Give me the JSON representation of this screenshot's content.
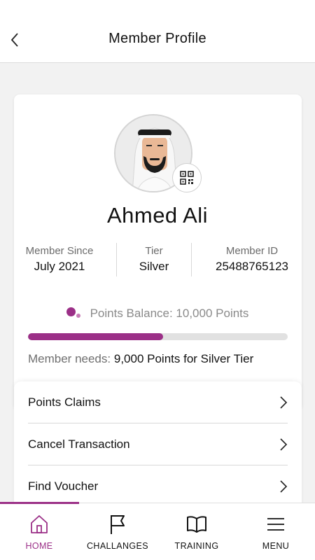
{
  "header": {
    "title": "Member Profile"
  },
  "profile": {
    "name": "Ahmed Ali",
    "stats": [
      {
        "label": "Member Since",
        "value": "July 2021"
      },
      {
        "label": "Tier",
        "value": "Silver"
      },
      {
        "label": "Member ID",
        "value": "25488765123"
      }
    ],
    "points_balance": "Points Balance: 10,000 Points",
    "progress_fraction": 0.52,
    "needs_prefix": "Member needs:",
    "needs_value": "9,000 Points for Silver Tier"
  },
  "menu": {
    "items": [
      {
        "label": "Points Claims"
      },
      {
        "label": "Cancel Transaction"
      },
      {
        "label": "Find Voucher"
      }
    ]
  },
  "nav": {
    "items": [
      {
        "label": "HOME",
        "icon": "home-icon"
      },
      {
        "label": "CHALLANGES",
        "icon": "flag-icon"
      },
      {
        "label": "TRAINING",
        "icon": "book-icon"
      },
      {
        "label": "MENU",
        "icon": "menu-icon"
      }
    ]
  },
  "colors": {
    "accent": "#9b2f87",
    "progress_track": "#e1e1e1"
  }
}
